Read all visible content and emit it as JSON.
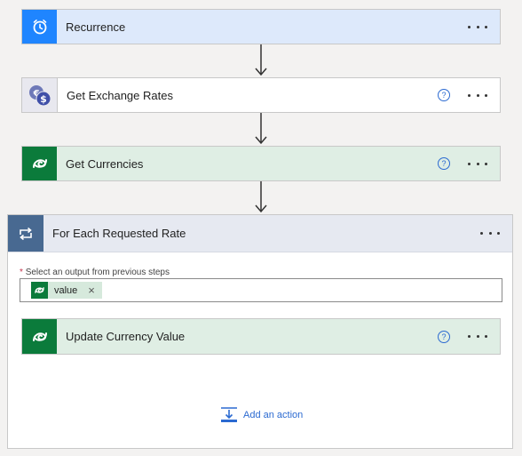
{
  "steps": {
    "recurrence": {
      "title": "Recurrence",
      "icon": "alarm-clock-icon",
      "color": "#1f85ff",
      "bg": "#dde9fb"
    },
    "exchange": {
      "title": "Get Exchange Rates",
      "icon": "currency-exchange-icon",
      "help": "?"
    },
    "currencies": {
      "title": "Get Currencies",
      "icon": "dataverse-icon",
      "color": "#0b7b3b",
      "bg": "#dfeee4",
      "help": "?"
    }
  },
  "foreach": {
    "title": "For Each Requested Rate",
    "icon": "loop-icon",
    "color": "#486991",
    "field_required": "*",
    "field_label": "Select an output from previous steps",
    "token": {
      "text": "value",
      "remove": "×"
    },
    "inner_step": {
      "title": "Update Currency Value",
      "help": "?"
    },
    "add_action_label": "Add an action"
  }
}
